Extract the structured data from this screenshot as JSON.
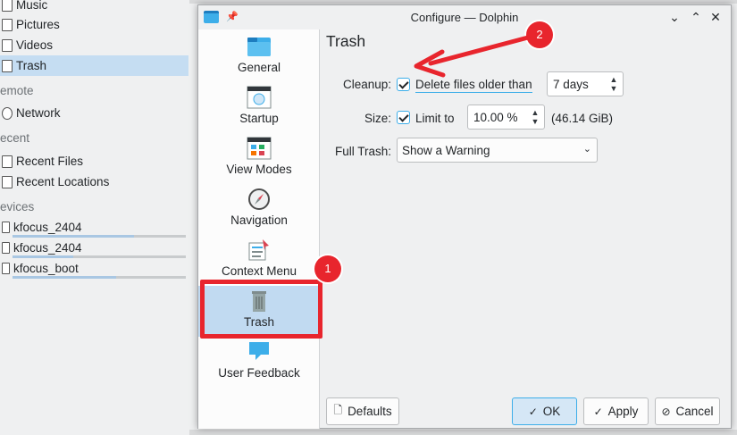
{
  "background": {
    "places": [
      {
        "label": "Music",
        "icon": "folder-music-icon"
      },
      {
        "label": "Pictures",
        "icon": "folder-pictures-icon"
      },
      {
        "label": "Videos",
        "icon": "folder-videos-icon"
      },
      {
        "label": "Trash",
        "icon": "trash-icon",
        "active": true
      }
    ],
    "remote_heading": "emote",
    "remote": [
      {
        "label": "Network",
        "icon": "network-icon"
      }
    ],
    "recent_heading": "ecent",
    "recent": [
      {
        "label": "Recent Files",
        "icon": "recent-files-icon"
      },
      {
        "label": "Recent Locations",
        "icon": "recent-locations-icon"
      }
    ],
    "devices_heading": "evices",
    "devices": [
      {
        "label": "kfocus_2404",
        "icon": "drive-icon",
        "usage": 0.7
      },
      {
        "label": "kfocus_2404",
        "icon": "drive-locked-icon",
        "usage": 0.35
      },
      {
        "label": "kfocus_boot",
        "icon": "drive-icon",
        "usage": 0.6
      }
    ]
  },
  "dialog": {
    "title": "Configure — Dolphin",
    "window_buttons": {
      "minimize": "⌄",
      "maximize": "⌃",
      "close": "✕"
    },
    "pages": [
      {
        "label": "General",
        "icon": "general-folder-icon"
      },
      {
        "label": "Startup",
        "icon": "startup-window-icon"
      },
      {
        "label": "View Modes",
        "icon": "view-modes-icon"
      },
      {
        "label": "Navigation",
        "icon": "compass-icon"
      },
      {
        "label": "Context Menu",
        "icon": "context-menu-icon"
      },
      {
        "label": "Trash",
        "icon": "trash-can-icon",
        "selected": true
      },
      {
        "label": "User Feedback",
        "icon": "feedback-icon"
      }
    ],
    "content": {
      "title": "Trash",
      "cleanup_label": "Cleanup:",
      "cleanup_checkbox": "Delete files older than",
      "cleanup_checked": true,
      "cleanup_value": "7 days",
      "size_label": "Size:",
      "size_checkbox": "Limit to",
      "size_checked": true,
      "size_value": "10.00 %",
      "size_info": "(46.14 GiB)",
      "full_trash_label": "Full Trash:",
      "full_trash_value": "Show a Warning"
    },
    "buttons": {
      "defaults": "Defaults",
      "ok": "OK",
      "apply": "Apply",
      "cancel": "Cancel"
    }
  },
  "annotations": {
    "badge1": "1",
    "badge2": "2",
    "color": "#e8252d"
  }
}
